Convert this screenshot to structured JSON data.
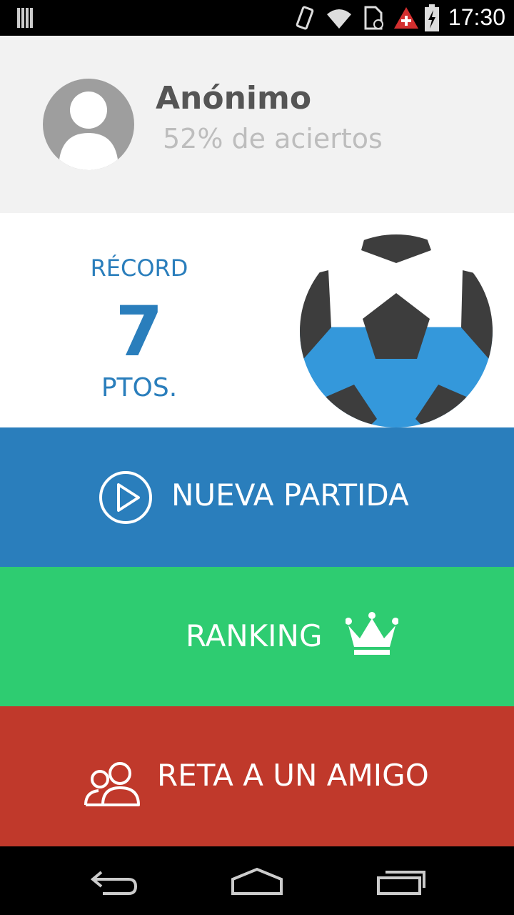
{
  "status_bar": {
    "time": "17:30"
  },
  "profile": {
    "name": "Anónimo",
    "stats": "52% de aciertos"
  },
  "record": {
    "label": "RÉCORD",
    "value": "7",
    "units": "PTOS.",
    "ball_fill_fraction": 0.52
  },
  "actions": {
    "new_game": "NUEVA PARTIDA",
    "ranking": "RANKING",
    "challenge": "RETA A UN AMIGO"
  },
  "colors": {
    "blue": "#2a7ebc",
    "green": "#2ecc71",
    "red": "#c0392b",
    "ball_fill": "#3498db"
  },
  "icons": {
    "status": [
      "notification-icon",
      "vibrate-icon",
      "wifi-icon",
      "sim-icon",
      "alert-icon",
      "battery-charging-icon"
    ],
    "nav": [
      "back-icon",
      "home-icon",
      "recents-icon"
    ]
  }
}
